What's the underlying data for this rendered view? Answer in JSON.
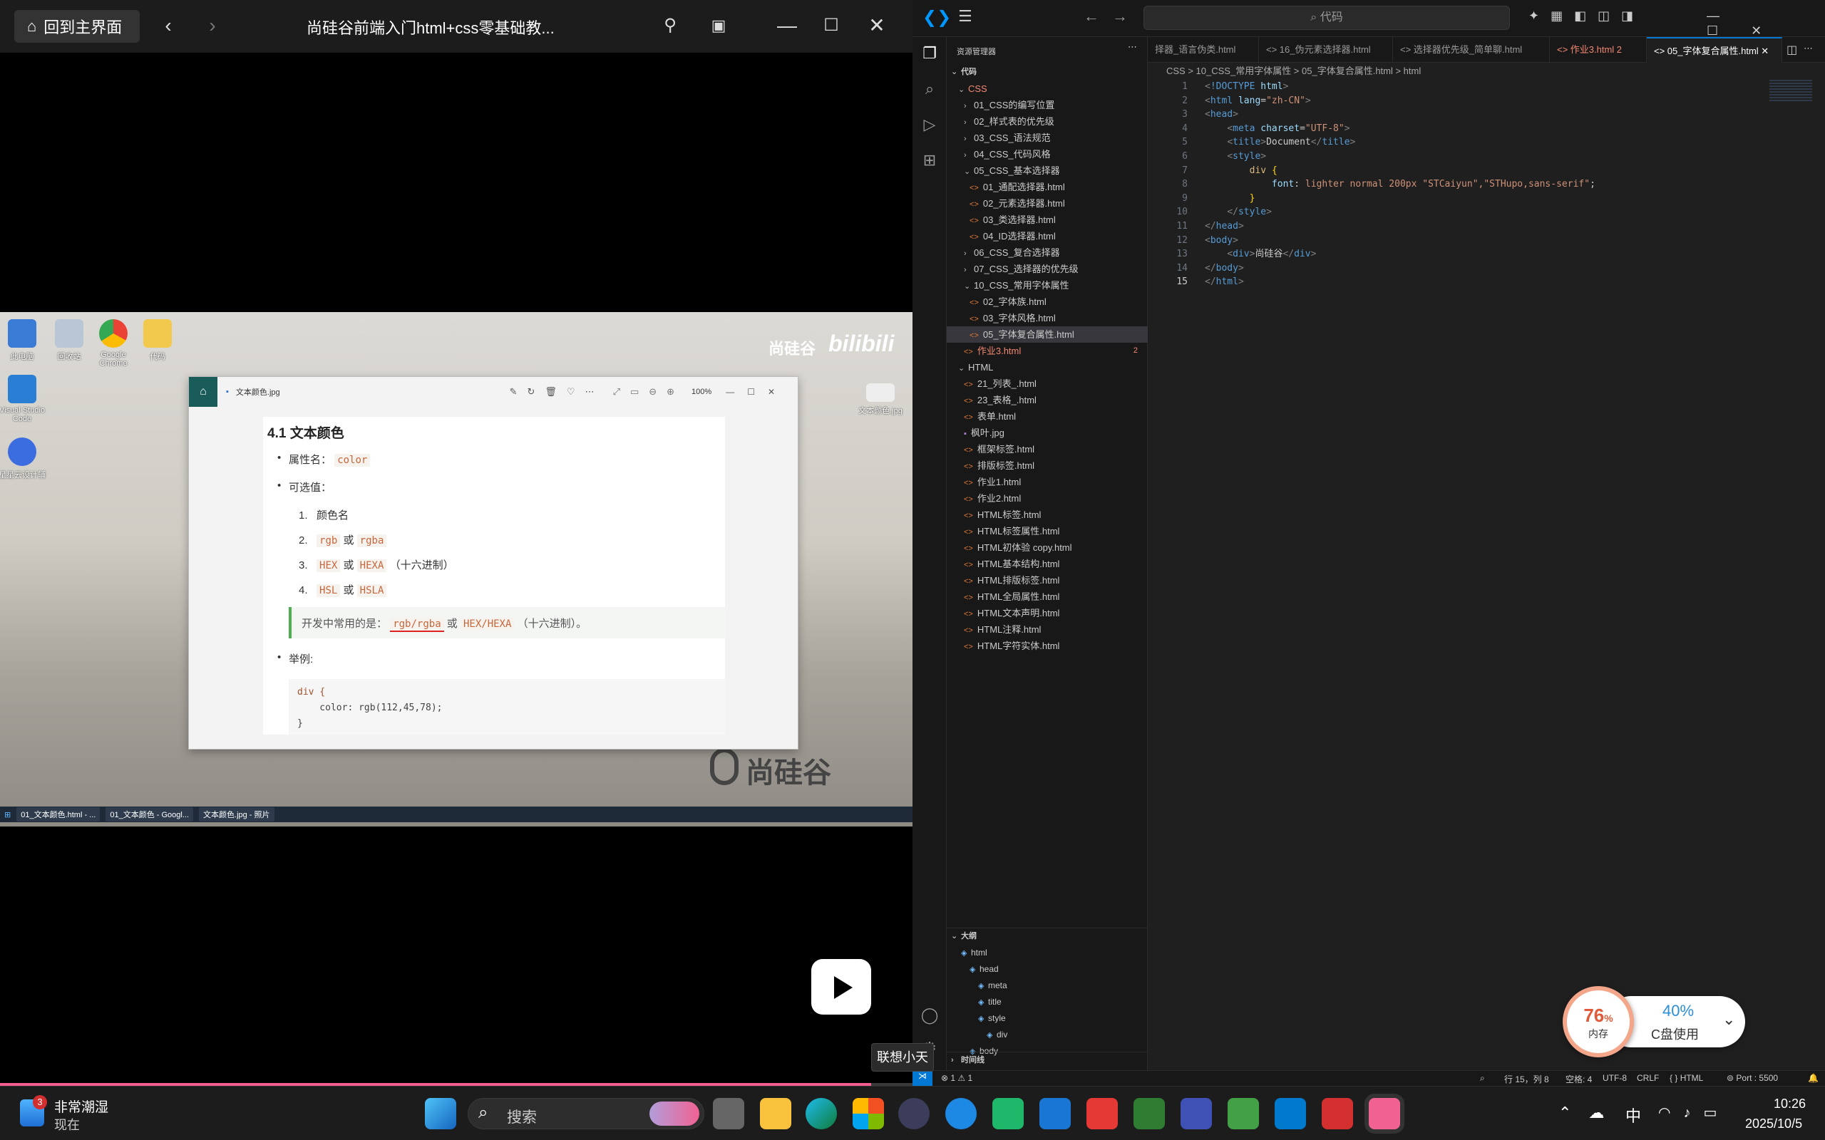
{
  "player": {
    "home_label": "回到主界面",
    "title": "尚硅谷前端入门html+css零基础教...",
    "progress": 0.955
  },
  "video": {
    "brand_top": "尚硅谷",
    "brand_bottom": "尚硅谷",
    "desktop_icons": [
      "此电脑",
      "回收站",
      "Google Chrome",
      "代码",
      "Visual Studio Code",
      "星星云设计辅"
    ],
    "desktop_icon_right": "文本颜色.jpg",
    "image_viewer": {
      "filename": "文本颜色.jpg",
      "zoom": "100%",
      "heading": "4.1 文本颜色",
      "prop_label": "属性名：",
      "prop_value": "color",
      "values_label": "可选值：",
      "opt1": "颜色名",
      "opt2a": "rgb",
      "opt2b": "或",
      "opt2c": "rgba",
      "opt3a": "HEX",
      "opt3b": "或",
      "opt3c": "HEXA",
      "opt3d": "（十六进制）",
      "opt4a": "HSL",
      "opt4b": "或",
      "opt4c": "HSLA",
      "quote_a": "开发中常用的是：",
      "quote_b": "rgb/rgba",
      "quote_c": "或",
      "quote_d": "HEX/HEXA",
      "quote_e": "（十六进制）。",
      "example_label": "举例:",
      "code1": "div {",
      "code2": "    color: rgb(112,45,78);",
      "code3": "}"
    },
    "win_tasks": [
      "01_文本颜色.html - ...",
      "01_文本颜色 - Googl...",
      "文本颜色.jpg - 照片"
    ]
  },
  "vscode": {
    "search": "代码",
    "explorer_title": "资源管理器",
    "root": "代码",
    "tree": [
      {
        "label": "CSS",
        "depth": 1,
        "type": "folder",
        "open": true,
        "red": true
      },
      {
        "label": "01_CSS的编写位置",
        "depth": 2,
        "type": "folder"
      },
      {
        "label": "02_样式表的优先级",
        "depth": 2,
        "type": "folder"
      },
      {
        "label": "03_CSS_语法规范",
        "depth": 2,
        "type": "folder"
      },
      {
        "label": "04_CSS_代码风格",
        "depth": 2,
        "type": "folder"
      },
      {
        "label": "05_CSS_基本选择器",
        "depth": 2,
        "type": "folder",
        "open": true
      },
      {
        "label": "01_通配选择器.html",
        "depth": 3,
        "type": "file"
      },
      {
        "label": "02_元素选择器.html",
        "depth": 3,
        "type": "file"
      },
      {
        "label": "03_类选择器.html",
        "depth": 3,
        "type": "file"
      },
      {
        "label": "04_ID选择器.html",
        "depth": 3,
        "type": "file"
      },
      {
        "label": "06_CSS_复合选择器",
        "depth": 2,
        "type": "folder"
      },
      {
        "label": "07_CSS_选择器的优先级",
        "depth": 2,
        "type": "folder"
      },
      {
        "label": "10_CSS_常用字体属性",
        "depth": 2,
        "type": "folder",
        "open": true
      },
      {
        "label": "02_字体族.html",
        "depth": 3,
        "type": "file"
      },
      {
        "label": "03_字体风格.html",
        "depth": 3,
        "type": "file"
      },
      {
        "label": "05_字体复合属性.html",
        "depth": 3,
        "type": "file",
        "selected": true
      },
      {
        "label": "作业3.html",
        "depth": 2,
        "type": "file",
        "red": true,
        "badge": "2"
      },
      {
        "label": "HTML",
        "depth": 1,
        "type": "folder",
        "open": true
      },
      {
        "label": "21_列表_.html",
        "depth": 2,
        "type": "file"
      },
      {
        "label": "23_表格_.html",
        "depth": 2,
        "type": "file"
      },
      {
        "label": "表单.html",
        "depth": 2,
        "type": "file"
      },
      {
        "label": "枫叶.jpg",
        "depth": 2,
        "type": "image"
      },
      {
        "label": "框架标签.html",
        "depth": 2,
        "type": "file"
      },
      {
        "label": "排版标签.html",
        "depth": 2,
        "type": "file"
      },
      {
        "label": "作业1.html",
        "depth": 2,
        "type": "file"
      },
      {
        "label": "作业2.html",
        "depth": 2,
        "type": "file"
      },
      {
        "label": "HTML标签.html",
        "depth": 2,
        "type": "file"
      },
      {
        "label": "HTML标签属性.html",
        "depth": 2,
        "type": "file"
      },
      {
        "label": "HTML初体验 copy.html",
        "depth": 2,
        "type": "file"
      },
      {
        "label": "HTML基本结构.html",
        "depth": 2,
        "type": "file"
      },
      {
        "label": "HTML排版标签.html",
        "depth": 2,
        "type": "file"
      },
      {
        "label": "HTML全局属性.html",
        "depth": 2,
        "type": "file"
      },
      {
        "label": "HTML文本声明.html",
        "depth": 2,
        "type": "file"
      },
      {
        "label": "HTML注释.html",
        "depth": 2,
        "type": "file"
      },
      {
        "label": "HTML字符实体.html",
        "depth": 2,
        "type": "file"
      }
    ],
    "outline_title": "大纲",
    "outline": [
      {
        "label": "html",
        "depth": 1
      },
      {
        "label": "head",
        "depth": 2
      },
      {
        "label": "meta",
        "depth": 3
      },
      {
        "label": "title",
        "depth": 3
      },
      {
        "label": "style",
        "depth": 3
      },
      {
        "label": "div",
        "depth": 4
      },
      {
        "label": "body",
        "depth": 2
      }
    ],
    "timeline_title": "时间线",
    "tabs": [
      {
        "label": "择器_语言伪类.html"
      },
      {
        "label": "16_伪元素选择器.html"
      },
      {
        "label": "选择器优先级_简单聊.html"
      },
      {
        "label": "作业3.html 2",
        "red": true
      },
      {
        "label": "05_字体复合属性.html",
        "active": true
      }
    ],
    "breadcrumb": "CSS > 10_CSS_常用字体属性 > 05_字体复合属性.html > html",
    "code_lines": [
      "1",
      "2",
      "3",
      "4",
      "5",
      "6",
      "7",
      "8",
      "9",
      "10",
      "11",
      "12",
      "13",
      "14",
      "15"
    ],
    "status": {
      "problems": "⊗ 1 ⚠ 1",
      "position": "行 15，列 8",
      "spaces": "空格: 4",
      "encoding": "UTF-8",
      "eol": "CRLF",
      "language": "HTML",
      "port": "Port : 5500"
    }
  },
  "widget": {
    "mem_percent": "76",
    "mem_unit": "%",
    "mem_label": "内存",
    "disk_percent": "40%",
    "disk_label": "C盘使用"
  },
  "tooltip": "联想小天",
  "taskbar": {
    "weather_badge": "3",
    "weather_title": "非常潮湿",
    "weather_sub": "现在",
    "search_placeholder": "搜索",
    "ime": "中",
    "time": "10:26",
    "date": "2025/10/5"
  }
}
